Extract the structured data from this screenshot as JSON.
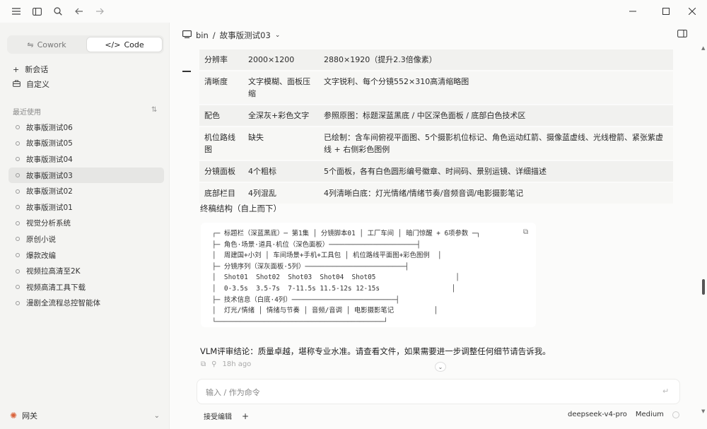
{
  "titlebar": {
    "icons": [
      "menu-icon",
      "sidebar-toggle-icon",
      "search-icon",
      "back-arrow-icon",
      "forward-arrow-icon"
    ],
    "window_controls": [
      "minimize-icon",
      "maximize-icon",
      "close-icon"
    ]
  },
  "sidebar": {
    "modes": [
      {
        "label": "Cowork",
        "icon": "cowork-icon",
        "active": false
      },
      {
        "label": "Code",
        "icon": "code-icon",
        "active": true
      }
    ],
    "actions": [
      {
        "label": "新会话",
        "icon": "plus-icon"
      },
      {
        "label": "自定义",
        "icon": "briefcase-icon"
      }
    ],
    "recent_label": "最近使用",
    "recent_items": [
      {
        "label": "故事版测试06",
        "active": false
      },
      {
        "label": "故事版测试05",
        "active": false
      },
      {
        "label": "故事版测试04",
        "active": false
      },
      {
        "label": "故事版测试03",
        "active": true
      },
      {
        "label": "故事版测试02",
        "active": false
      },
      {
        "label": "故事版测试01",
        "active": false
      },
      {
        "label": "视觉分析系统",
        "active": false
      },
      {
        "label": "原创小说",
        "active": false
      },
      {
        "label": "爆款改编",
        "active": false
      },
      {
        "label": "视频拉高清至2K",
        "active": false
      },
      {
        "label": "视频高清工具下载",
        "active": false
      },
      {
        "label": "漫剧全流程总控智能体",
        "active": false
      }
    ],
    "footer": {
      "label": "网关",
      "icon": "gateway-icon"
    }
  },
  "header": {
    "folder": "bin",
    "separator": "/",
    "project": "故事版测试03",
    "chevron": "⌄"
  },
  "table": {
    "rows": [
      {
        "item": "分辨率",
        "before": "2000×1200",
        "after": "2880×1920（提升2.3倍像素）"
      },
      {
        "item": "清晰度",
        "before": "文字模糊、面板压缩",
        "after": "文字锐利、每个分镜552×310高清缩略图"
      },
      {
        "item": "配色",
        "before": "全深灰+彩色文字",
        "after": "参照原图：标题深蓝黑底 / 中区深色面板 / 底部白色技术区"
      },
      {
        "item": "机位路线图",
        "before": "缺失",
        "after": "已绘制：含车间俯视平面图、5个摄影机位标记、角色运动红箭、摄像蓝虚线、光线橙箭、紧张紫虚线 + 右侧彩色图例"
      },
      {
        "item": "分镜面板",
        "before": "4个粗标",
        "after": "5个面板，各有白色圆形编号徽章、时间码、景别运镜、详细描述"
      },
      {
        "item": "底部栏目",
        "before": "4列混乱",
        "after": "4列清晰白底：灯光情绪/情绪节奏/音频音调/电影摄影笔记"
      }
    ]
  },
  "structure_heading": "终稿结构（自上而下）",
  "code_lines": [
    "┌─ 标题栏（深蓝黑底）─ 第1集 │ 分镜脚本01 │ 工厂车间 │ 暗门惊醒 + 6项参数 ─┐",
    "├─ 角色·场景·道具·机位（深色面板）──────────────────────┤",
    "│  周建国+小刘 │ 车间场景+手机+工具包 │ 机位路线平面图+彩色图例  │",
    "├─ 分镜序列（深灰面板·5列）─────────────────────────┤",
    "│  Shot01  Shot02  Shot03  Shot04  Shot05                    │",
    "│  0-3.5s  3.5-7s  7-11.5s 11.5-12s 12-15s                  │",
    "├─ 技术信息（白底·4列）──────────────────────────┤",
    "│  灯光/情绪 │ 情绪与节奏 │ 音频/音调 │ 电影摄影笔记          │",
    "└──────────────────────────────────────────┘"
  ],
  "verdict": "VLM评审结论：质量卓越，堪称专业水准。请查看文件，如果需要进一步调整任何细节请告诉我。",
  "meta": {
    "timestamp": "18h ago"
  },
  "composer": {
    "placeholder": "输入 / 作为命令",
    "left_action": "接受编辑",
    "add_label": "+",
    "model": "deepseek-v4-pro",
    "effort": "Medium"
  },
  "colors": {
    "sidebar_bg": "#f4f4f2",
    "active_item_bg": "#e6e6e4",
    "gateway_accent": "#d9623a"
  }
}
